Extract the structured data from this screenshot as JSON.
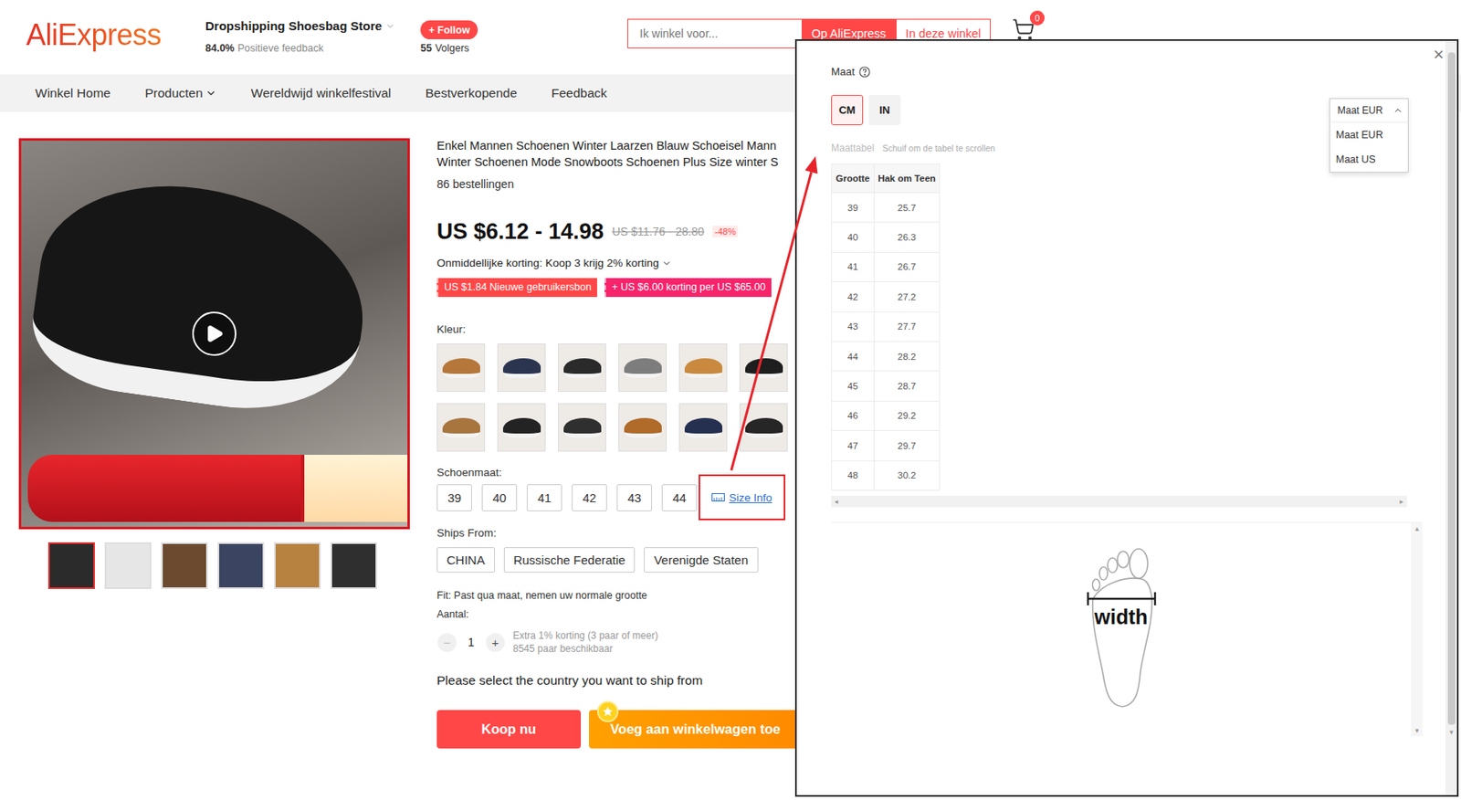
{
  "header": {
    "logo": "AliExpress",
    "store_name": "Dropshipping Shoesbag Store",
    "feedback_value": "84.0%",
    "feedback_label": "Positieve feedback",
    "follow": "+ Follow",
    "followers_count": "55",
    "followers_label": "Volgers",
    "search_placeholder": "Ik winkel voor...",
    "search_scopes": [
      {
        "label": "Op AliExpress",
        "selected": true
      },
      {
        "label": "In deze winkel",
        "selected": false
      }
    ],
    "cart_count": "0"
  },
  "nav": [
    {
      "label": "Winkel Home",
      "has_menu": false
    },
    {
      "label": "Producten",
      "has_menu": true
    },
    {
      "label": "Wereldwijd winkelfestival",
      "has_menu": false
    },
    {
      "label": "Bestverkopende",
      "has_menu": false
    },
    {
      "label": "Feedback",
      "has_menu": false
    }
  ],
  "gallery": {
    "thumbnails": [
      {
        "selected": true,
        "color": "#2b2b2b"
      },
      {
        "selected": false,
        "color": "#e6e6e6"
      },
      {
        "selected": false,
        "color": "#6b4a30"
      },
      {
        "selected": false,
        "color": "#3b4460"
      },
      {
        "selected": false,
        "color": "#b7813f"
      },
      {
        "selected": false,
        "color": "#2f2f2f"
      }
    ]
  },
  "product": {
    "title_lines": [
      "Enkel Mannen Schoenen Winter Laarzen Blauw Schoeisel Mann",
      "Winter Schoenen Mode Snowboots Schoenen Plus Size winter S"
    ],
    "orders": "86 bestellingen",
    "price": "US $6.12 - 14.98",
    "original_price": "US $11.76 - 28.80",
    "discount": "-48%",
    "instant_discount": "Onmiddellijke korting: Koop 3 krijg 2% korting",
    "coupons": [
      {
        "label": "US $1.84 Nieuwe gebruikersbon",
        "color": "#ff4747"
      },
      {
        "label": "+ US $6.00 korting per US $65.00",
        "color": "#f7236b"
      }
    ],
    "color_label": "Kleur:",
    "colors": [
      {
        "color": "#b5773a",
        "selected": false
      },
      {
        "color": "#2b3550",
        "selected": false
      },
      {
        "color": "#2a2a2a",
        "selected": false
      },
      {
        "color": "#7d7d7d",
        "selected": false
      },
      {
        "color": "#c98a3f",
        "selected": false
      },
      {
        "color": "#1e1e1e",
        "selected": false
      },
      {
        "color": "#a8753f",
        "selected": false
      },
      {
        "color": "#232323",
        "selected": false
      },
      {
        "color": "#2f2f2f",
        "selected": false
      },
      {
        "color": "#b06a2a",
        "selected": false
      },
      {
        "color": "#253050",
        "selected": false
      },
      {
        "color": "#262626",
        "selected": false
      }
    ],
    "size_label": "Schoenmaat:",
    "sizes": [
      {
        "label": "39",
        "selected": false
      },
      {
        "label": "40",
        "selected": false
      },
      {
        "label": "41",
        "selected": false
      },
      {
        "label": "42",
        "selected": false
      },
      {
        "label": "43",
        "selected": false
      },
      {
        "label": "44",
        "selected": false
      }
    ],
    "size_info": {
      "label": "Size Info",
      "highlighted": true
    },
    "ships_label": "Ships From:",
    "ships_from": [
      {
        "label": "CHINA",
        "selected": false
      },
      {
        "label": "Russische Federatie",
        "selected": false
      },
      {
        "label": "Verenigde Staten",
        "selected": false
      }
    ],
    "fit": "Fit: Past qua maat, nemen uw normale grootte",
    "quantity_label": "Aantal:",
    "quantity": "1",
    "decrement": "−",
    "decrement_disabled": true,
    "increment": "+",
    "bulk_discount": "Extra 1% korting (3 paar of meer)",
    "stock": "8545 paar beschikbaar",
    "ship_notice": "Please select the country you want to ship from",
    "buy_now": "Koop nu",
    "add_to_cart": "Voeg aan winkelwagen toe"
  },
  "annotation": {
    "arrow": true
  },
  "size_chart": {
    "close": "×",
    "title": "Maat",
    "units": [
      {
        "label": "CM",
        "selected": true
      },
      {
        "label": "IN",
        "selected": false
      }
    ],
    "dropdown": {
      "value": "Maat EUR",
      "expanded": true,
      "options": [
        "Maat EUR",
        "Maat US"
      ]
    },
    "table_title": "Maattabel",
    "table_hint": "Schuif om de tabel te scrollen",
    "columns": [
      "Grootte",
      "Hak om Teen"
    ],
    "rows": [
      [
        "39",
        "25.7"
      ],
      [
        "40",
        "26.3"
      ],
      [
        "41",
        "26.7"
      ],
      [
        "42",
        "27.2"
      ],
      [
        "43",
        "27.7"
      ],
      [
        "44",
        "28.2"
      ],
      [
        "45",
        "28.7"
      ],
      [
        "46",
        "29.2"
      ],
      [
        "47",
        "29.7"
      ],
      [
        "48",
        "30.2"
      ]
    ],
    "diagram_label": "width",
    "scroll_glyphs": {
      "up": "▴",
      "down": "▾",
      "left": "◂",
      "right": "▸"
    }
  }
}
